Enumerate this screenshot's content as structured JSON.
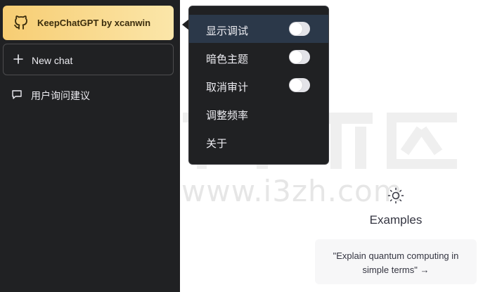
{
  "sidebar": {
    "keep_button_label": "KeepChatGPT by xcanwin",
    "keep_button_icon": "github-icon",
    "new_chat_label": "New chat",
    "suggestion_label": "用户询问建议"
  },
  "menu": {
    "items": [
      {
        "label": "显示调试",
        "toggle": false,
        "highlighted": true
      },
      {
        "label": "暗色主题",
        "toggle": false,
        "highlighted": false
      },
      {
        "label": "取消审计",
        "toggle": false,
        "highlighted": false
      },
      {
        "label": "调整频率"
      },
      {
        "label": "关于"
      }
    ]
  },
  "watermark": {
    "text": "www.i3zh.com"
  },
  "main": {
    "examples_title": "Examples",
    "example_card": "\"Explain quantum computing in simple terms\" →"
  },
  "colors": {
    "sidebar_bg": "#202123",
    "keep_gradient_start": "#f7cd73",
    "keep_gradient_end": "#fbe6a9",
    "menu_highlight": "#2b3849"
  }
}
